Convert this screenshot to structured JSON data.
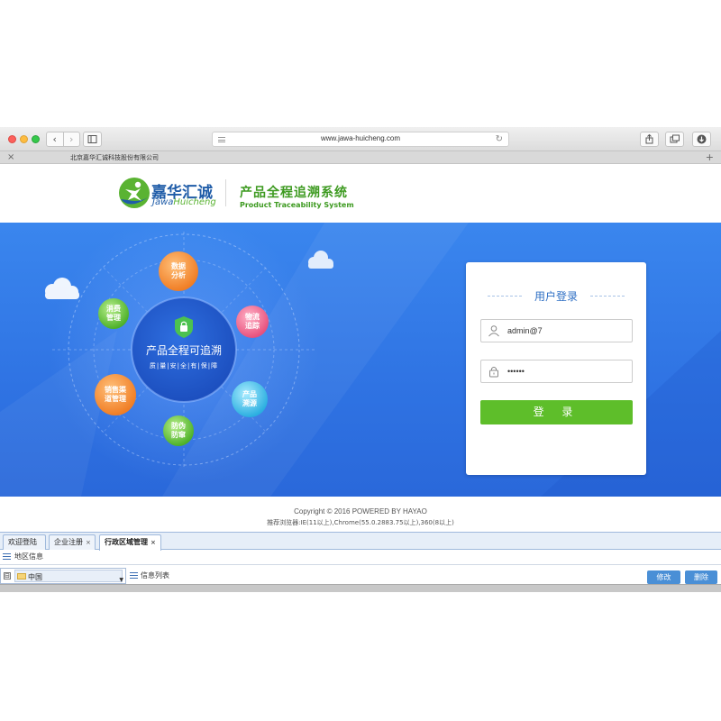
{
  "browser": {
    "url": "www.jawa-huicheng.com",
    "tab_title": "北京嘉华汇诚科技股份有限公司",
    "tab_close": "×",
    "tab_add": "+"
  },
  "header": {
    "brand_cn": "嘉华汇诚",
    "brand_en_a": "Jawa",
    "brand_en_b": "Huicheng",
    "system_cn": "产品全程追溯系统",
    "system_en": "Product Traceability System"
  },
  "banner": {
    "center_title": "产品全程可追溯",
    "center_sub": "质|量|安|全|有|保|障",
    "bubbles": {
      "data_analysis": [
        "数据",
        "分析"
      ],
      "consumption": [
        "消费",
        "管理"
      ],
      "logistics": [
        "物流",
        "追踪"
      ],
      "sales_channel": [
        "销售渠",
        "道管理"
      ],
      "origin": [
        "产品",
        "溯源"
      ],
      "anti_fake": [
        "防伪",
        "防窜"
      ]
    }
  },
  "login": {
    "title": "用户登录",
    "username_value": "admin@7",
    "password_value": "••••••",
    "submit_label": "登 录"
  },
  "footer": {
    "copyright": "Copyright © 2016 POWERED BY HAYAO",
    "recommend": "推荐浏览器:IE(11以上),Chrome(55.0.2883.75以上),360(8以上)"
  },
  "admin": {
    "tabs": [
      {
        "label": "欢迎登陆",
        "close": ""
      },
      {
        "label": "企业注册",
        "close": "×"
      },
      {
        "label": "行政区域管理",
        "close": "×"
      }
    ],
    "region_panel_title": "地区信息",
    "list_panel_title": "信息列表",
    "tree_expander": "⊟",
    "tree_node": "中国",
    "edit_button": "修改",
    "delete_button": "删除"
  },
  "colors": {
    "brand_blue": "#1f5ca8",
    "brand_green": "#3d9a20",
    "banner_blue": "#2f73e3",
    "login_button": "#5ebe2a",
    "admin_button": "#4a8fd6"
  }
}
